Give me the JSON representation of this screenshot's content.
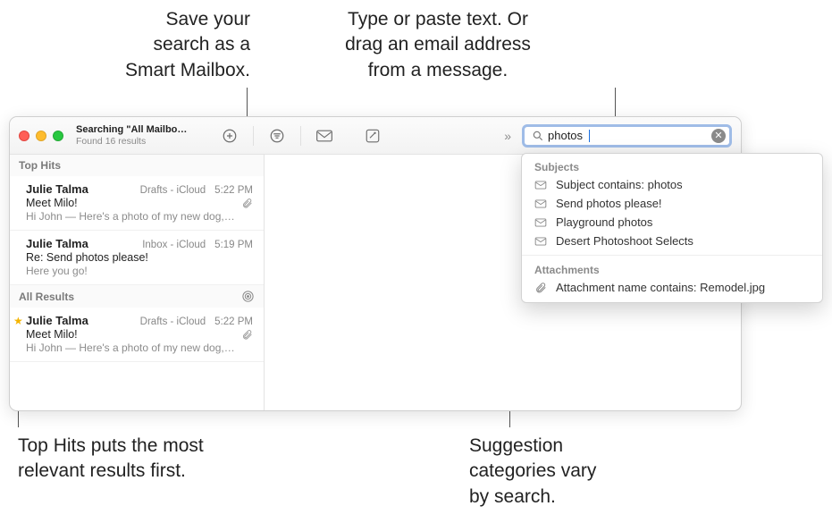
{
  "callouts": {
    "smartMailbox": "Save your\nsearch as a\nSmart Mailbox.",
    "searchField": "Type or paste text. Or\ndrag an email address\nfrom a message.",
    "topHits": "Top Hits puts the most\nrelevant results first.",
    "suggestions": "Suggestion\ncategories vary\nby search."
  },
  "window": {
    "title": "Searching \"All Mailbo…",
    "subtitle": "Found 16 results"
  },
  "search": {
    "value": "photos"
  },
  "sections": {
    "topHits": "Top Hits",
    "allResults": "All Results"
  },
  "messages": {
    "topHits": [
      {
        "sender": "Julie Talma",
        "location": "Drafts - iCloud",
        "time": "5:22 PM",
        "subject": "Meet Milo!",
        "preview": "Hi John — Here's a photo of my new dog,…",
        "hasAttachment": true
      },
      {
        "sender": "Julie Talma",
        "location": "Inbox - iCloud",
        "time": "5:19 PM",
        "subject": "Re: Send photos please!",
        "preview": "Here you go!",
        "hasAttachment": false
      }
    ],
    "allResults": [
      {
        "sender": "Julie Talma",
        "location": "Drafts - iCloud",
        "time": "5:22 PM",
        "subject": "Meet Milo!",
        "preview": "Hi John — Here's a photo of my new dog,…",
        "hasAttachment": true,
        "starred": true
      }
    ]
  },
  "suggestions": {
    "subjectsHeader": "Subjects",
    "subjects": [
      "Subject contains: photos",
      "Send photos please!",
      "Playground photos",
      "Desert Photoshoot Selects"
    ],
    "attachmentsHeader": "Attachments",
    "attachments": [
      "Attachment name contains: Remodel.jpg"
    ]
  }
}
